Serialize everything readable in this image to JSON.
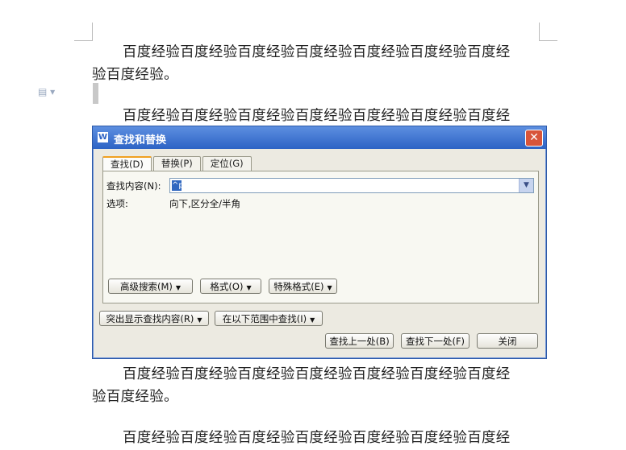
{
  "document": {
    "paragraphs": [
      {
        "line1": "百度经验百度经验百度经验百度经验百度经验百度经验百度经",
        "line2": "验百度经验。"
      },
      {
        "line1": "百度经验百度经验百度经验百度经验百度经验百度经验百度经",
        "line2": ""
      },
      {
        "line1": "百度经验百度经验百度经验百度经验百度经验百度经验百度经",
        "line2": "验百度经验。"
      },
      {
        "line1": "百度经验百度经验百度经验百度经验百度经验百度经验百度经",
        "line2": ""
      }
    ]
  },
  "dialog": {
    "title": "查找和替换",
    "close": "✕",
    "app_icon": "W",
    "tabs": [
      "查找(D)",
      "替换(P)",
      "定位(G)"
    ],
    "find_label": "查找内容(N):",
    "find_value": "^p",
    "options_label": "选项:",
    "options_value": "向下,区分全/半角",
    "advanced_btn": "高级搜索(M)",
    "format_btn": "格式(O)",
    "special_btn": "特殊格式(E)",
    "highlight_btn": "突出显示查找内容(R)",
    "range_btn": "在以下范围中查找(I)",
    "prev_btn": "查找上一处(B)",
    "next_btn": "查找下一处(F)",
    "close_btn": "关闭"
  },
  "icons": {
    "margin": "document-icon",
    "dropdown": "chevron-down-icon"
  }
}
